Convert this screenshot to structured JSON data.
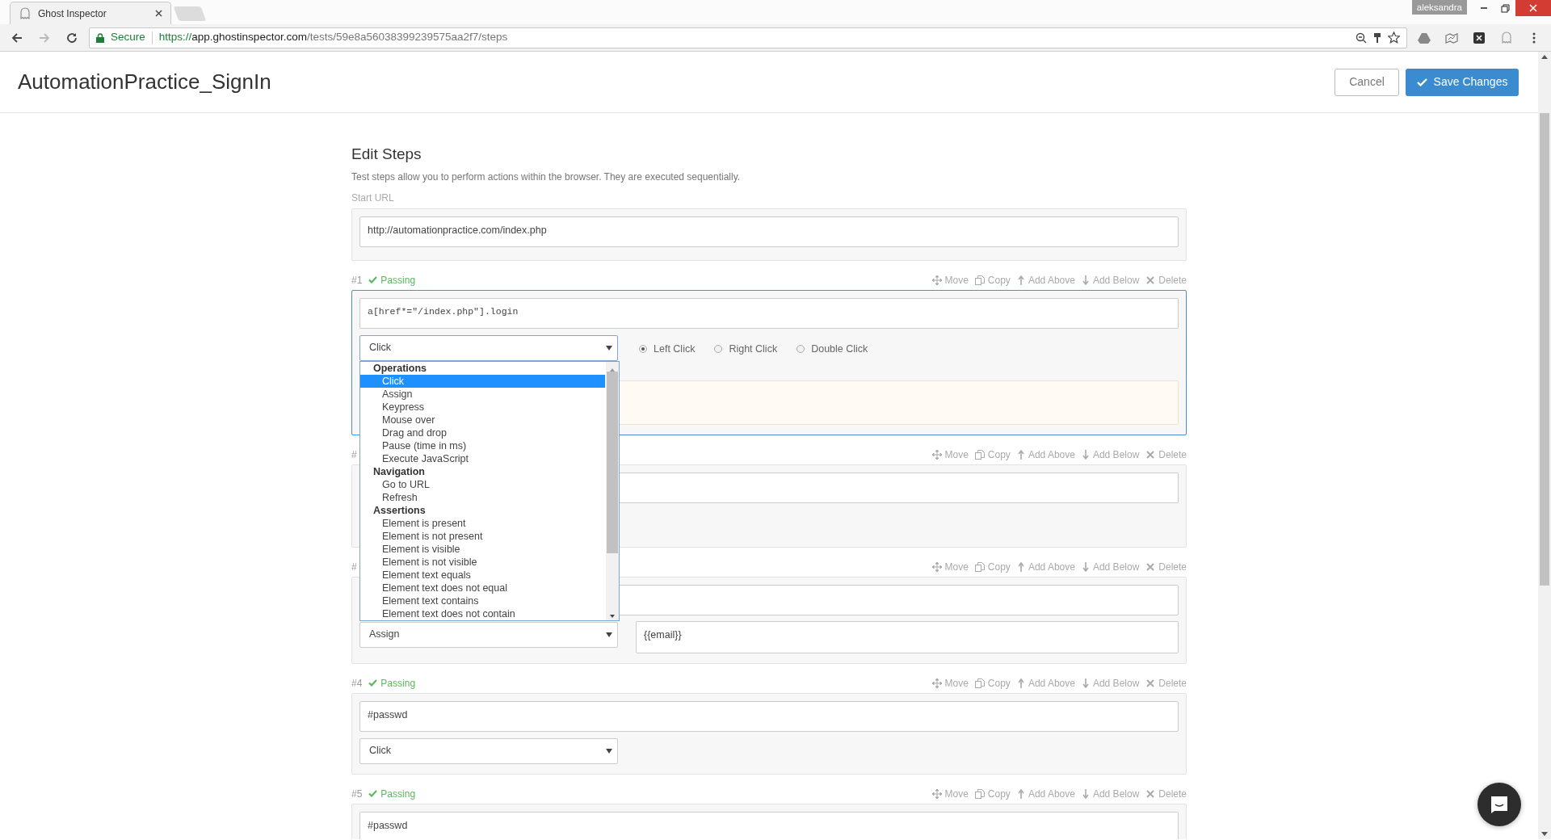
{
  "browser": {
    "tab": {
      "title": "Ghost Inspector"
    },
    "profile": "aleksandra",
    "security": "Secure",
    "url": {
      "scheme": "https://",
      "host": "app.ghostinspector.com",
      "path": "/tests/59e8a56038399239575aa2f7/steps"
    }
  },
  "header": {
    "title": "AutomationPractice_SignIn",
    "buttons": [
      {
        "label": "Cancel",
        "kind": "default"
      },
      {
        "label": "Save Changes",
        "kind": "primary"
      }
    ]
  },
  "editor": {
    "heading": "Edit Steps",
    "description": "Test steps allow you to perform actions within the browser. They are executed sequentially.",
    "start_url": {
      "label": "Start URL",
      "value": "http://automationpractice.com/index.php"
    }
  },
  "steps": [
    {
      "number": "#1",
      "status": "Passing",
      "focused": true,
      "actions": [
        "Move",
        "Copy",
        "Add Above",
        "Add Below",
        "Delete"
      ],
      "selector": "a[href*=\"/index.php\"].login",
      "action": "Click",
      "click_options": [
        {
          "label": "Left Click",
          "selected": true
        },
        {
          "label": "Right Click",
          "selected": false
        },
        {
          "label": "Double Click",
          "selected": false
        }
      ],
      "note_field": true,
      "menu": {
        "groups": [
          {
            "label": "Operations",
            "options": [
              {
                "label": "Click",
                "selected": true
              },
              {
                "label": "Assign",
                "selected": false
              },
              {
                "label": "Keypress",
                "selected": false
              },
              {
                "label": "Mouse over",
                "selected": false
              },
              {
                "label": "Drag and drop",
                "selected": false
              },
              {
                "label": "Pause (time in ms)",
                "selected": false
              },
              {
                "label": "Execute JavaScript",
                "selected": false
              }
            ]
          },
          {
            "label": "Navigation",
            "options": [
              {
                "label": "Go to URL",
                "selected": false
              },
              {
                "label": "Refresh",
                "selected": false
              }
            ]
          },
          {
            "label": "Assertions",
            "options": [
              {
                "label": "Element is present",
                "selected": false
              },
              {
                "label": "Element is not present",
                "selected": false
              },
              {
                "label": "Element is visible",
                "selected": false
              },
              {
                "label": "Element is not visible",
                "selected": false
              },
              {
                "label": "Element text equals",
                "selected": false
              },
              {
                "label": "Element text does not equal",
                "selected": false
              },
              {
                "label": "Element text contains",
                "selected": false
              },
              {
                "label": "Element text does not contain",
                "selected": false
              }
            ]
          }
        ]
      }
    },
    {
      "number": "#",
      "focused": false,
      "actions": [
        "Move",
        "Copy",
        "Add Above",
        "Add Below",
        "Delete"
      ]
    },
    {
      "number": "#",
      "focused": false,
      "actions": [
        "Move",
        "Copy",
        "Add Above",
        "Add Below",
        "Delete"
      ],
      "action": "Assign",
      "value": "{{email}}"
    },
    {
      "number": "#4",
      "status": "Passing",
      "focused": false,
      "actions": [
        "Move",
        "Copy",
        "Add Above",
        "Add Below",
        "Delete"
      ],
      "selector": "#passwd",
      "action": "Click"
    },
    {
      "number": "#5",
      "status": "Passing",
      "focused": false,
      "actions": [
        "Move",
        "Copy",
        "Add Above",
        "Add Below",
        "Delete"
      ],
      "selector": "#passwd"
    }
  ]
}
